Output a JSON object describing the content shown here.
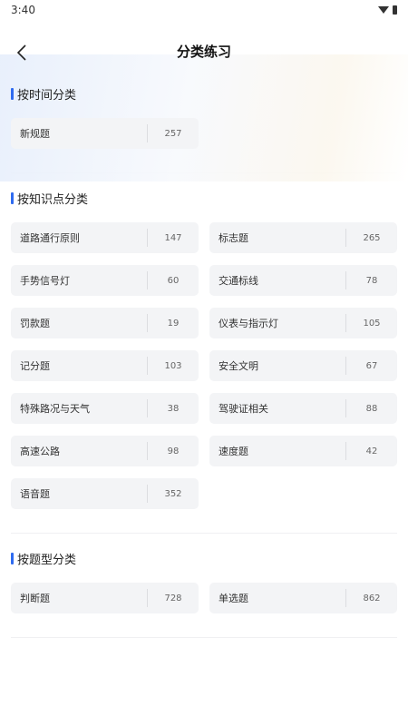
{
  "status_bar": {
    "time": "3:40"
  },
  "header": {
    "title": "分类练习"
  },
  "sections": [
    {
      "title": "按时间分类",
      "items": [
        {
          "label": "新规题",
          "count": "257"
        }
      ]
    },
    {
      "title": "按知识点分类",
      "items": [
        {
          "label": "道路通行原则",
          "count": "147"
        },
        {
          "label": "标志题",
          "count": "265"
        },
        {
          "label": "手势信号灯",
          "count": "60"
        },
        {
          "label": "交通标线",
          "count": "78"
        },
        {
          "label": "罚款题",
          "count": "19"
        },
        {
          "label": "仪表与指示灯",
          "count": "105"
        },
        {
          "label": "记分题",
          "count": "103"
        },
        {
          "label": "安全文明",
          "count": "67"
        },
        {
          "label": "特殊路况与天气",
          "count": "38"
        },
        {
          "label": "驾驶证相关",
          "count": "88"
        },
        {
          "label": "高速公路",
          "count": "98"
        },
        {
          "label": "速度题",
          "count": "42"
        },
        {
          "label": "语音题",
          "count": "352"
        }
      ]
    },
    {
      "title": "按题型分类",
      "items": [
        {
          "label": "判断题",
          "count": "728"
        },
        {
          "label": "单选题",
          "count": "862"
        }
      ]
    }
  ],
  "colors": {
    "accent": "#2f6bf0",
    "card_bg": "#f3f4f6"
  },
  "icons": {
    "back": "chevron-left-icon",
    "wifi": "wifi-icon",
    "battery": "battery-icon"
  }
}
